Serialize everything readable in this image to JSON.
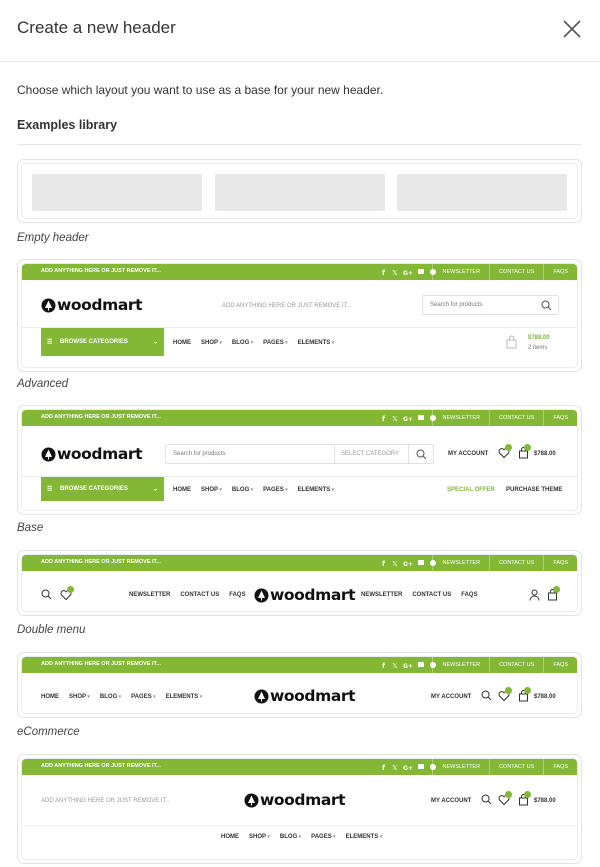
{
  "modal": {
    "title": "Create a new header",
    "intro": "Choose which layout you want to use as a base for your new header.",
    "library_title": "Examples library"
  },
  "layouts": [
    {
      "label": "Empty header"
    },
    {
      "label": "Advanced"
    },
    {
      "label": "Base"
    },
    {
      "label": "Double menu"
    },
    {
      "label": "eCommerce"
    }
  ],
  "preview": {
    "topbar_text": "ADD ANYTHING HERE OR JUST REMOVE IT...",
    "topbar_links": [
      "NEWSLETTER",
      "CONTACT US",
      "FAQS"
    ],
    "logo": "woodmart",
    "center_text": "ADD ANYTHING HERE OR JUST REMOVE IT...",
    "search_placeholder": "Search for products",
    "select_category": "SELECT CATEGORY",
    "browse_categories": "BROWSE CATEGORIES",
    "menu": [
      "HOME",
      "SHOP",
      "BLOG",
      "PAGES",
      "ELEMENTS"
    ],
    "cart_price": "$788.00",
    "cart_items": "2 items",
    "my_account": "MY ACCOUNT",
    "special_offer": "SPECIAL OFFER",
    "purchase_theme": "PURCHASE THEME",
    "double_menu_left": [
      "NEWSLETTER",
      "CONTACT US",
      "FAQS"
    ],
    "double_menu_right": [
      "NEWSLETTER",
      "CONTACT US",
      "FAQS"
    ]
  },
  "colors": {
    "accent": "#83b735"
  }
}
